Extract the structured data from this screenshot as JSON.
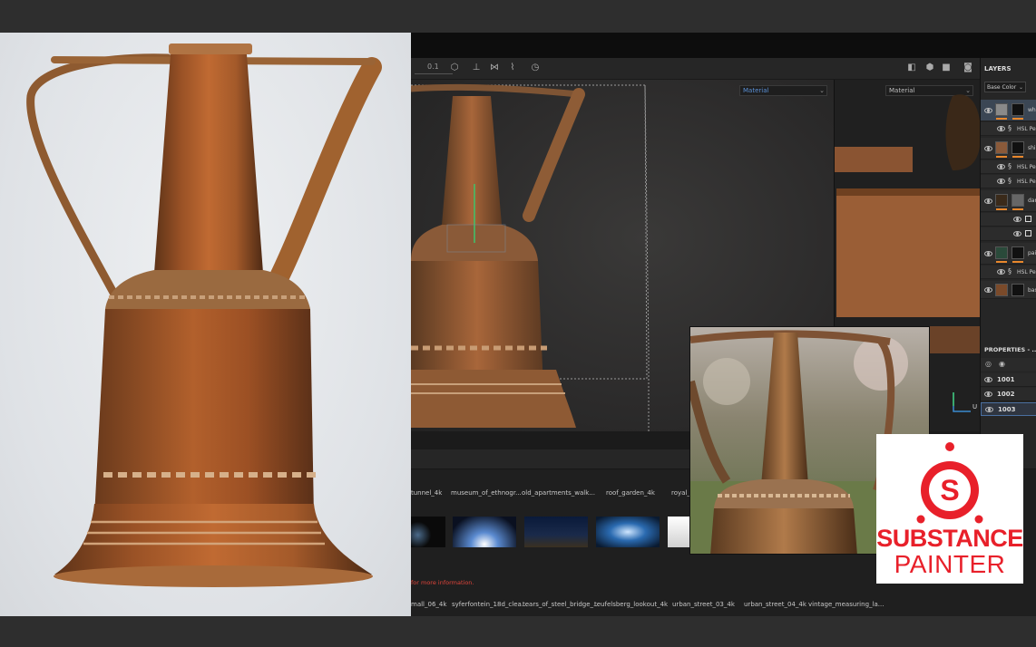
{
  "toolbar": {
    "value_readout": "0.1"
  },
  "viewport_3d": {
    "channel_dropdown": "Material"
  },
  "viewport_2d": {
    "channel_dropdown": "Material"
  },
  "layers": {
    "title": "LAYERS",
    "channel_dropdown": "Base Color",
    "items": [
      {
        "label": "whi"
      },
      {
        "label": "HSL Pe"
      },
      {
        "label": "shi"
      },
      {
        "label": "HSL Pe"
      },
      {
        "label": "HSL Pe"
      },
      {
        "label": "dar"
      },
      {
        "label": "pai"
      },
      {
        "label": "HSL Pe"
      },
      {
        "label": "bas"
      }
    ]
  },
  "properties": {
    "title": "PROPERTIES - ...",
    "uv_tiles": [
      "1001",
      "1002",
      "1003"
    ]
  },
  "axis_gizmo": {
    "u_label": "U"
  },
  "shelf": {
    "row1_labels": [
      "tunnel_4k",
      "museum_of_ethnogr...",
      "old_apartments_walk...",
      "roof_garden_4k",
      "royal_..."
    ],
    "row2_labels": [
      "mall_06_4k",
      "syferfontein_18d_clea...",
      "tears_of_steel_bridge_...",
      "teufelsberg_lookout_4k",
      "urban_street_03_4k",
      "urban_street_04_4k",
      "vintage_measuring_la..."
    ],
    "status": "for more information."
  },
  "logo": {
    "line1": "SUBSTANCE",
    "line2": "PAINTER"
  },
  "colors": {
    "brand_red": "#e8202a",
    "layer_accent": "#e8872c",
    "status_red": "#e0443a"
  }
}
